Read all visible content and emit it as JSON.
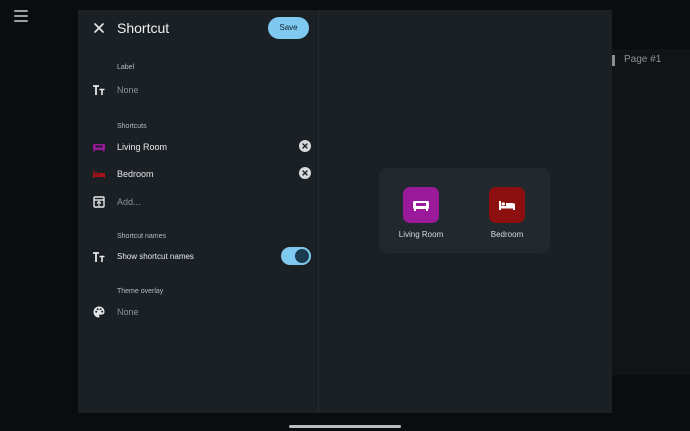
{
  "dialog": {
    "title": "Shortcut",
    "save_label": "Save"
  },
  "label_section": {
    "heading": "Label",
    "value": "None"
  },
  "shortcuts_section": {
    "heading": "Shortcuts",
    "items": [
      {
        "label": "Living Room",
        "color": "#9b1a9b",
        "icon": "sofa-icon"
      },
      {
        "label": "Bedroom",
        "color": "#a3151a",
        "icon": "bed-icon"
      }
    ],
    "add_label": "Add..."
  },
  "shortcut_names_section": {
    "heading": "Shortcut names",
    "toggle_label": "Show shortcut names",
    "toggle_on": true
  },
  "theme_section": {
    "heading": "Theme overlay",
    "value": "None"
  },
  "preview": {
    "tiles": [
      {
        "label": "Living Room",
        "color": "#9b1a9b",
        "icon": "sofa-icon"
      },
      {
        "label": "Bedroom",
        "color": "#8c0f0f",
        "icon": "bed-icon"
      }
    ]
  },
  "background": {
    "page_label": "Page #1"
  },
  "colors": {
    "accent": "#7fc8ef",
    "dialog_bg": "#1b2024"
  }
}
